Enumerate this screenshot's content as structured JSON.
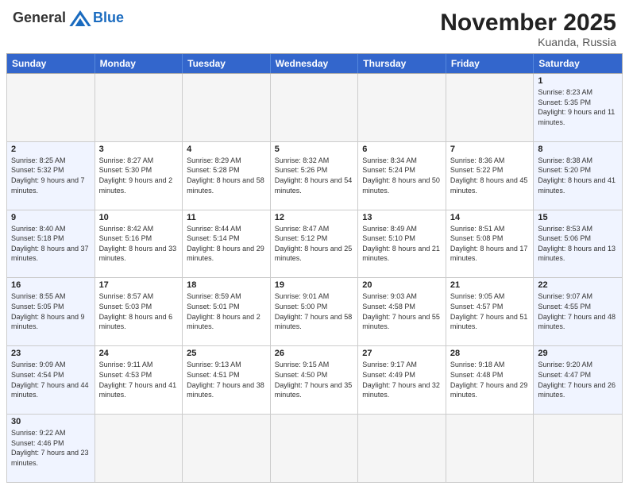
{
  "header": {
    "logo_general": "General",
    "logo_blue": "Blue",
    "month_title": "November 2025",
    "location": "Kuanda, Russia"
  },
  "day_headers": [
    "Sunday",
    "Monday",
    "Tuesday",
    "Wednesday",
    "Thursday",
    "Friday",
    "Saturday"
  ],
  "weeks": [
    [
      {
        "day": "",
        "empty": true
      },
      {
        "day": "",
        "empty": true
      },
      {
        "day": "",
        "empty": true
      },
      {
        "day": "",
        "empty": true
      },
      {
        "day": "",
        "empty": true
      },
      {
        "day": "",
        "empty": true
      },
      {
        "day": "1",
        "sunrise": "Sunrise: 8:23 AM",
        "sunset": "Sunset: 5:35 PM",
        "daylight": "Daylight: 9 hours and 11 minutes.",
        "weekend": true
      }
    ],
    [
      {
        "day": "2",
        "sunrise": "Sunrise: 8:25 AM",
        "sunset": "Sunset: 5:32 PM",
        "daylight": "Daylight: 9 hours and 7 minutes.",
        "weekend": true
      },
      {
        "day": "3",
        "sunrise": "Sunrise: 8:27 AM",
        "sunset": "Sunset: 5:30 PM",
        "daylight": "Daylight: 9 hours and 2 minutes."
      },
      {
        "day": "4",
        "sunrise": "Sunrise: 8:29 AM",
        "sunset": "Sunset: 5:28 PM",
        "daylight": "Daylight: 8 hours and 58 minutes."
      },
      {
        "day": "5",
        "sunrise": "Sunrise: 8:32 AM",
        "sunset": "Sunset: 5:26 PM",
        "daylight": "Daylight: 8 hours and 54 minutes."
      },
      {
        "day": "6",
        "sunrise": "Sunrise: 8:34 AM",
        "sunset": "Sunset: 5:24 PM",
        "daylight": "Daylight: 8 hours and 50 minutes."
      },
      {
        "day": "7",
        "sunrise": "Sunrise: 8:36 AM",
        "sunset": "Sunset: 5:22 PM",
        "daylight": "Daylight: 8 hours and 45 minutes."
      },
      {
        "day": "8",
        "sunrise": "Sunrise: 8:38 AM",
        "sunset": "Sunset: 5:20 PM",
        "daylight": "Daylight: 8 hours and 41 minutes.",
        "weekend": true
      }
    ],
    [
      {
        "day": "9",
        "sunrise": "Sunrise: 8:40 AM",
        "sunset": "Sunset: 5:18 PM",
        "daylight": "Daylight: 8 hours and 37 minutes.",
        "weekend": true
      },
      {
        "day": "10",
        "sunrise": "Sunrise: 8:42 AM",
        "sunset": "Sunset: 5:16 PM",
        "daylight": "Daylight: 8 hours and 33 minutes."
      },
      {
        "day": "11",
        "sunrise": "Sunrise: 8:44 AM",
        "sunset": "Sunset: 5:14 PM",
        "daylight": "Daylight: 8 hours and 29 minutes."
      },
      {
        "day": "12",
        "sunrise": "Sunrise: 8:47 AM",
        "sunset": "Sunset: 5:12 PM",
        "daylight": "Daylight: 8 hours and 25 minutes."
      },
      {
        "day": "13",
        "sunrise": "Sunrise: 8:49 AM",
        "sunset": "Sunset: 5:10 PM",
        "daylight": "Daylight: 8 hours and 21 minutes."
      },
      {
        "day": "14",
        "sunrise": "Sunrise: 8:51 AM",
        "sunset": "Sunset: 5:08 PM",
        "daylight": "Daylight: 8 hours and 17 minutes."
      },
      {
        "day": "15",
        "sunrise": "Sunrise: 8:53 AM",
        "sunset": "Sunset: 5:06 PM",
        "daylight": "Daylight: 8 hours and 13 minutes.",
        "weekend": true
      }
    ],
    [
      {
        "day": "16",
        "sunrise": "Sunrise: 8:55 AM",
        "sunset": "Sunset: 5:05 PM",
        "daylight": "Daylight: 8 hours and 9 minutes.",
        "weekend": true
      },
      {
        "day": "17",
        "sunrise": "Sunrise: 8:57 AM",
        "sunset": "Sunset: 5:03 PM",
        "daylight": "Daylight: 8 hours and 6 minutes."
      },
      {
        "day": "18",
        "sunrise": "Sunrise: 8:59 AM",
        "sunset": "Sunset: 5:01 PM",
        "daylight": "Daylight: 8 hours and 2 minutes."
      },
      {
        "day": "19",
        "sunrise": "Sunrise: 9:01 AM",
        "sunset": "Sunset: 5:00 PM",
        "daylight": "Daylight: 7 hours and 58 minutes."
      },
      {
        "day": "20",
        "sunrise": "Sunrise: 9:03 AM",
        "sunset": "Sunset: 4:58 PM",
        "daylight": "Daylight: 7 hours and 55 minutes."
      },
      {
        "day": "21",
        "sunrise": "Sunrise: 9:05 AM",
        "sunset": "Sunset: 4:57 PM",
        "daylight": "Daylight: 7 hours and 51 minutes."
      },
      {
        "day": "22",
        "sunrise": "Sunrise: 9:07 AM",
        "sunset": "Sunset: 4:55 PM",
        "daylight": "Daylight: 7 hours and 48 minutes.",
        "weekend": true
      }
    ],
    [
      {
        "day": "23",
        "sunrise": "Sunrise: 9:09 AM",
        "sunset": "Sunset: 4:54 PM",
        "daylight": "Daylight: 7 hours and 44 minutes.",
        "weekend": true
      },
      {
        "day": "24",
        "sunrise": "Sunrise: 9:11 AM",
        "sunset": "Sunset: 4:53 PM",
        "daylight": "Daylight: 7 hours and 41 minutes."
      },
      {
        "day": "25",
        "sunrise": "Sunrise: 9:13 AM",
        "sunset": "Sunset: 4:51 PM",
        "daylight": "Daylight: 7 hours and 38 minutes."
      },
      {
        "day": "26",
        "sunrise": "Sunrise: 9:15 AM",
        "sunset": "Sunset: 4:50 PM",
        "daylight": "Daylight: 7 hours and 35 minutes."
      },
      {
        "day": "27",
        "sunrise": "Sunrise: 9:17 AM",
        "sunset": "Sunset: 4:49 PM",
        "daylight": "Daylight: 7 hours and 32 minutes."
      },
      {
        "day": "28",
        "sunrise": "Sunrise: 9:18 AM",
        "sunset": "Sunset: 4:48 PM",
        "daylight": "Daylight: 7 hours and 29 minutes."
      },
      {
        "day": "29",
        "sunrise": "Sunrise: 9:20 AM",
        "sunset": "Sunset: 4:47 PM",
        "daylight": "Daylight: 7 hours and 26 minutes.",
        "weekend": true
      }
    ],
    [
      {
        "day": "30",
        "sunrise": "Sunrise: 9:22 AM",
        "sunset": "Sunset: 4:46 PM",
        "daylight": "Daylight: 7 hours and 23 minutes.",
        "weekend": true
      },
      {
        "day": "",
        "empty": true
      },
      {
        "day": "",
        "empty": true
      },
      {
        "day": "",
        "empty": true
      },
      {
        "day": "",
        "empty": true
      },
      {
        "day": "",
        "empty": true
      },
      {
        "day": "",
        "empty": true
      }
    ]
  ]
}
